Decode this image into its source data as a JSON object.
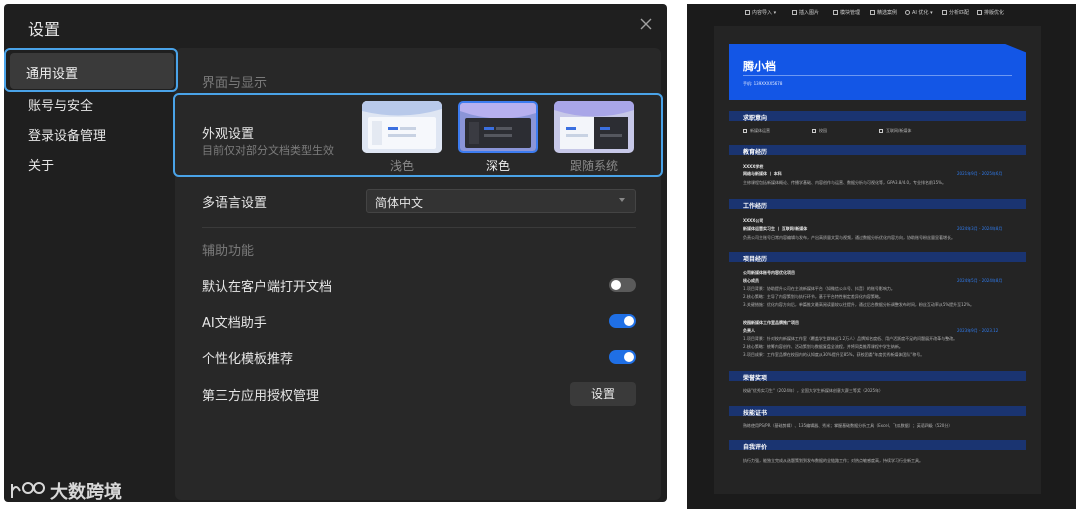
{
  "settings": {
    "title": "设置",
    "nav": [
      "通用设置",
      "账号与安全",
      "登录设备管理",
      "关于"
    ],
    "section_display": "界面与显示",
    "appearance_label": "外观设置",
    "appearance_note": "目前仅对部分文档类型生效",
    "themes": [
      {
        "label": "浅色",
        "selected": false
      },
      {
        "label": "深色",
        "selected": true
      },
      {
        "label": "跟随系统",
        "selected": false
      }
    ],
    "language_label": "多语言设置",
    "language_value": "简体中文",
    "section_assist": "辅助功能",
    "toggles": [
      {
        "label": "默认在客户端打开文档",
        "on": false
      },
      {
        "label": "AI文档助手",
        "on": true
      },
      {
        "label": "个性化模板推荐",
        "on": true
      }
    ],
    "third_party_label": "第三方应用授权管理",
    "third_party_button": "设置",
    "accent": "#1f6fe5",
    "highlight": "#4aa3e8"
  },
  "watermark": "大数跨境",
  "toolbar": [
    "内容导入",
    "插入图片",
    "模块管理",
    "精选案例",
    "AI 优化",
    "分析匹配",
    "排版优化"
  ],
  "resume": {
    "name": "腾小档",
    "phone": "手机: 139XXXX5678",
    "sections": {
      "intent": "求职意向",
      "education": "教育经历",
      "work": "工作经历",
      "projects": "项目经历",
      "honors": "荣誉奖项",
      "skills": "技能证书",
      "self": "自我评价"
    },
    "intent_items": [
      "新媒体运营",
      "校园",
      "互联网/新媒体"
    ],
    "education": {
      "school": "XXXX学校",
      "major": "网络与新媒体 丨 本科",
      "date": "2021年9月 - 2025年6月",
      "desc": "主修课程包括新媒体概论、传播学基础、内容创作与运营、数据分析与可视化等，GPA3.8/4.0，专业排名前15%。"
    },
    "work": {
      "company": "XXXX公司",
      "role": "新媒体运营实习生 丨 互联网/新媒体",
      "date": "2024年3月 - 2024年8月",
      "desc": "负责公司主账号日常内容编辑与发布，产出高质量文案与视频，通过数据分析优化内容方向，协助账号粉丝量显著增长。"
    },
    "projects": {
      "p1_title": "公司新媒体账号内容优化项目",
      "p1_role": "核心成员",
      "p1_date": "2024年5月 - 2024年8月",
      "p1_lines": [
        "1.项目背景：协助提升公司在主流新媒体平台（如微信公众号、抖音）的账号影响力。",
        "2.核心策略：主导了内容策划与执行环节，基于平台特性制定差异化内容策略。",
        "3.关键措施：优化内容方向后，单篇推文最高阅读量较以往提升，通过后台数据分析调整发布时间，粉丝互动率从5%提升至12%。"
      ],
      "p2_title": "校园新媒体工作室品牌推广项目",
      "p2_role": "负责人",
      "p2_date": "2023年9月 - 2023.12",
      "p2_lines": [
        "1.项目背景：针对校内新媒体工作室（覆盖学生群体近1.2万人）品牌知名度低、用户活跃度不足的问题展开改革与整改。",
        "2.核心策略：统筹内容创作、活动策划与数据复盘全流程，并将同类推荐课程中学生纳新。",
        "3.项目成果：工作室品牌在校园内的认知度从30%提升至85%，获校团委\"年度优秀新媒体团队\"称号。"
      ]
    },
    "honors": "校级\"优秀实习生\"（2024年），全国大学生新媒体创意大赛三等奖（2025年）",
    "skills": "熟练使用PS/PR（基础剪辑）、135编辑器、秀米；掌握基础数据分析工具（Excel、飞瓜数据）；英语四级（520分）",
    "self": "执行力强，能独立完成从选题策划到发布数据的全链路工作；对热点敏感度高，持续学习行业新工具。"
  }
}
